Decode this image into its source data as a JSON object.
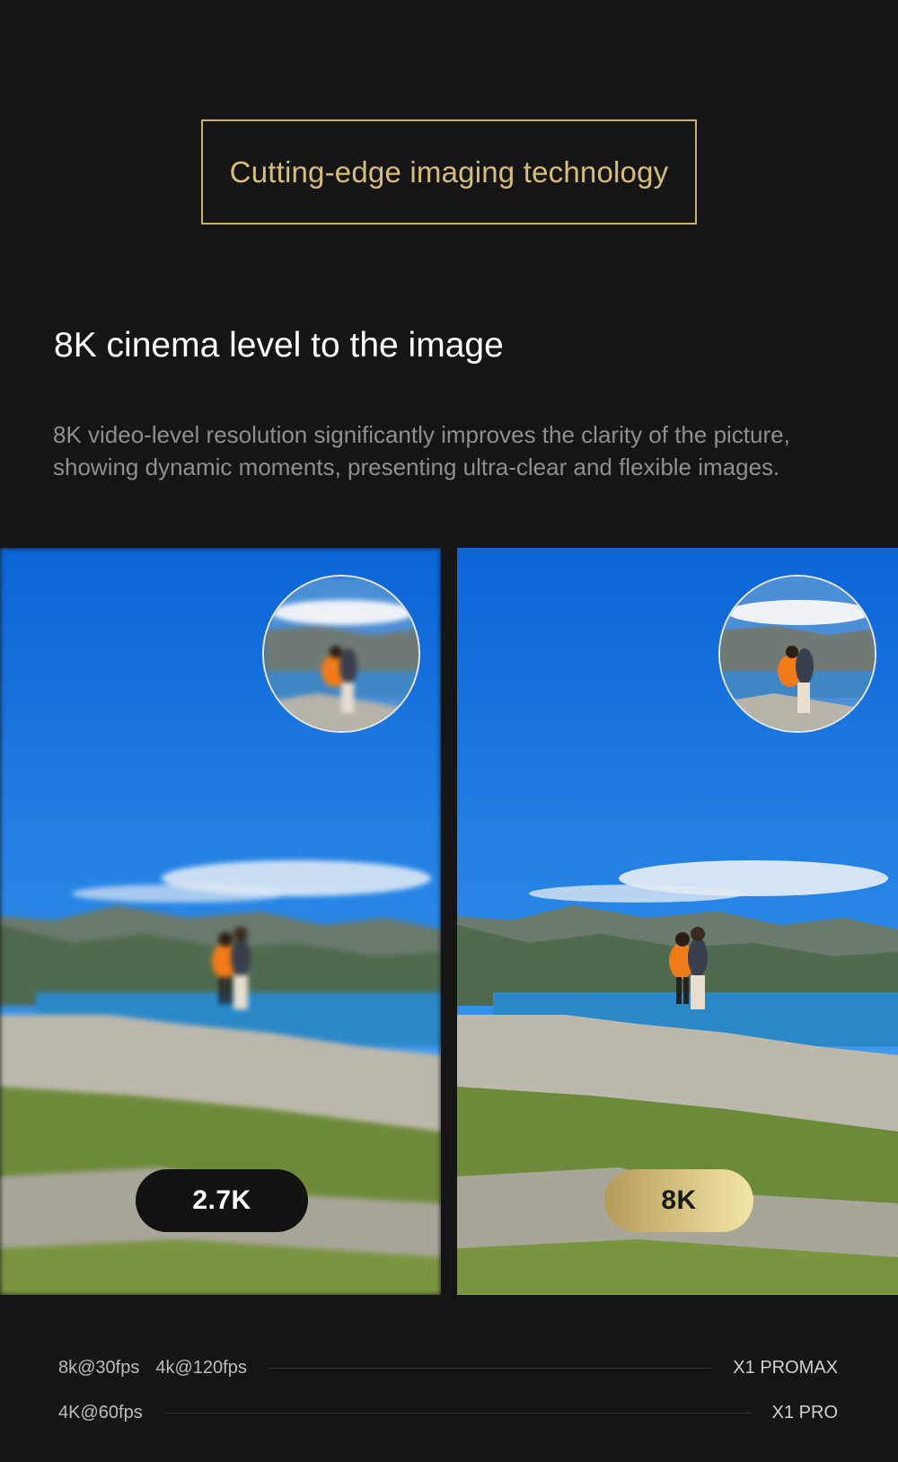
{
  "header": {
    "badge_title": "Cutting-edge imaging technology"
  },
  "section": {
    "title": "8K cinema level to the image",
    "description": "8K video-level resolution significantly improves the clarity of the picture, showing dynamic moments, presenting ultra-clear and flexible images."
  },
  "comparison": {
    "left_label": "2.7K",
    "right_label": "8K"
  },
  "specs": [
    {
      "modes": [
        "8k@30fps",
        "4k@120fps"
      ],
      "model": "X1 PROMAX"
    },
    {
      "modes": [
        "4K@60fps"
      ],
      "model": "X1 PRO"
    }
  ],
  "colors": {
    "background": "#151515",
    "accent_gold": "#c9b26e",
    "badge_gold_start": "#b59a5a",
    "badge_gold_end": "#f3e6a7"
  }
}
